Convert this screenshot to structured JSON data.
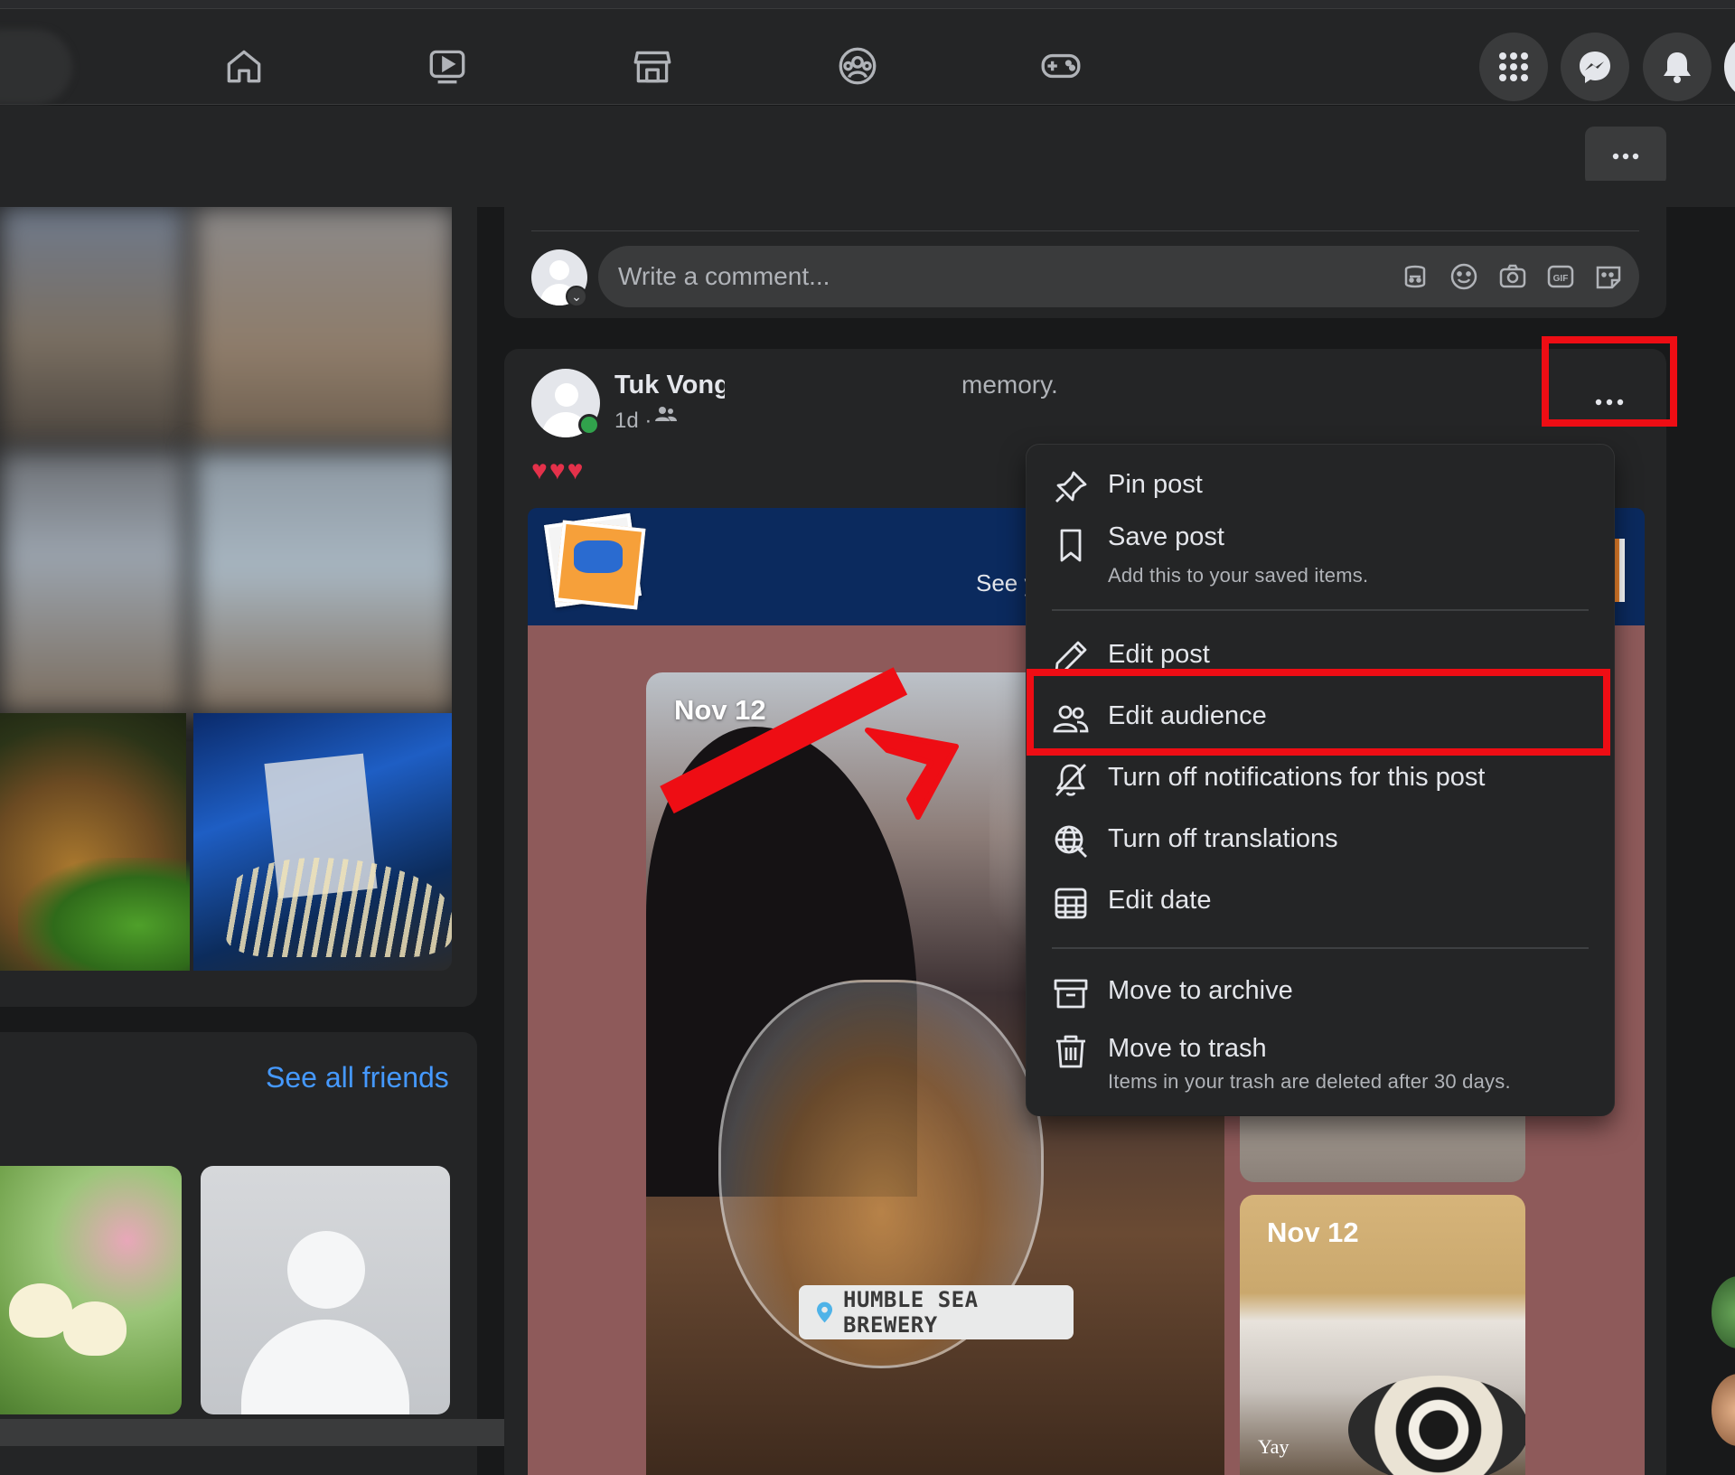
{
  "nav": {
    "icons": [
      "home-icon",
      "watch-icon",
      "marketplace-icon",
      "groups-icon",
      "gaming-icon"
    ],
    "right_buttons": [
      "menu-grid-icon",
      "messenger-icon",
      "notifications-icon"
    ]
  },
  "comment": {
    "placeholder": "Write a comment...",
    "tools": [
      "avatar-sticker-icon",
      "emoji-icon",
      "camera-icon",
      "gif-icon",
      "sticker-icon"
    ]
  },
  "post": {
    "author": "Tuk Vong",
    "time": "1d ·",
    "snippet": "memory.",
    "hearts": "♥♥♥",
    "banner_see": "See y",
    "photo1_date": "Nov 12",
    "photo2_date": "Nov 12",
    "photo2_caption": "Yay",
    "location": "HUMBLE SEA BREWERY"
  },
  "friends": {
    "see_all": "See all friends"
  },
  "menu": {
    "items": [
      {
        "label": "Pin post",
        "icon": "pin-icon"
      },
      {
        "label": "Save post",
        "sub": "Add this to your saved items.",
        "icon": "bookmark-icon"
      },
      {
        "label": "Edit post",
        "icon": "pencil-icon"
      },
      {
        "label": "Edit audience",
        "icon": "people-icon"
      },
      {
        "label": "Turn off notifications for this post",
        "icon": "bell-off-icon"
      },
      {
        "label": "Turn off translations",
        "icon": "globe-translate-icon"
      },
      {
        "label": "Edit date",
        "icon": "calendar-icon"
      },
      {
        "label": "Move to archive",
        "icon": "archive-icon"
      },
      {
        "label": "Move to trash",
        "sub": "Items in your trash are deleted after 30 days.",
        "icon": "trash-icon"
      }
    ]
  },
  "colors": {
    "background": "#18191a",
    "surface": "#242526",
    "text": "#e4e6eb",
    "secondary_text": "#b0b3b8",
    "link": "#4599ff",
    "annotation": "#ee0d14"
  }
}
